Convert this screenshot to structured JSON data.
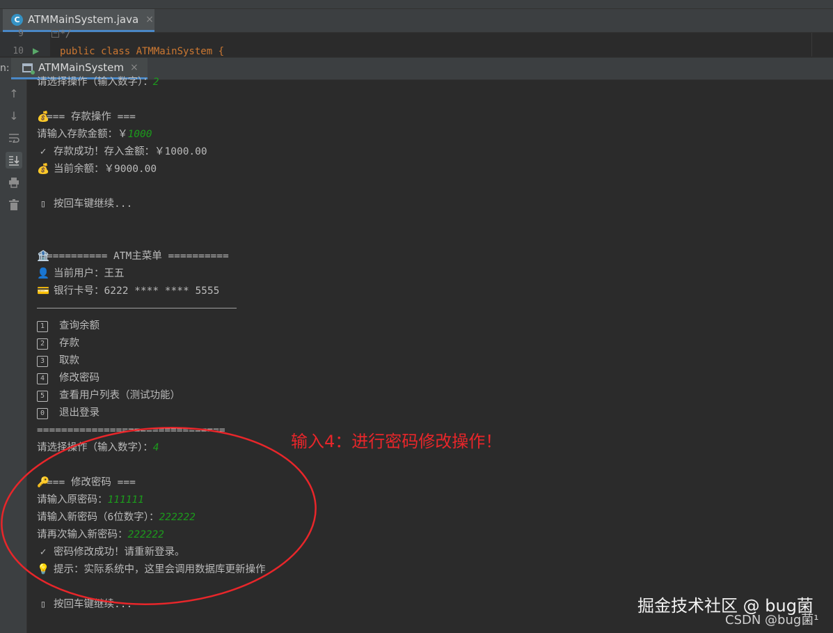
{
  "editor": {
    "tab_label": "ATMMainSystem.java",
    "tab_icon": "java-class-icon",
    "tab_close": "×",
    "line_9": "9",
    "line_10": "10",
    "code_9": "*/",
    "code_10": "public class ATMMainSystem {"
  },
  "run_panel": {
    "prefix": "n:",
    "tab_label": "ATMMainSystem",
    "tab_close": "×"
  },
  "console": {
    "l01": "请选择操作（输入数字）：",
    "l01_in": "2",
    "l02": "=== 存款操作 ===",
    "l03": "请输入存款金额：￥",
    "l03_in": "1000",
    "l04": "存款成功！存入金额：￥1000.00",
    "l05": "当前余额：￥9000.00",
    "l06": "按回车键继续...",
    "l07": "========== ATM主菜单 ==========",
    "l08": "当前用户：王五",
    "l09": "银行卡号：6222 **** **** 5555",
    "menu": [
      {
        "num": "1",
        "label": "查询余额"
      },
      {
        "num": "2",
        "label": "存款"
      },
      {
        "num": "3",
        "label": "取款"
      },
      {
        "num": "4",
        "label": "修改密码"
      },
      {
        "num": "5",
        "label": "查看用户列表（测试功能）"
      },
      {
        "num": "0",
        "label": "退出登录"
      }
    ],
    "sep": "===============================",
    "l10": "请选择操作（输入数字）：",
    "l10_in": "4",
    "l11": "=== 修改密码 ===",
    "l12": "请输入原密码：",
    "l12_in": "111111",
    "l13": "请输入新密码（6位数字）：",
    "l13_in": "222222",
    "l14": "请再次输入新密码：",
    "l14_in": "222222",
    "l15": "密码修改成功！请重新登录。",
    "l16": "提示：实际系统中，这里会调用数据库更新操作",
    "l17": "按回车键继续..."
  },
  "annotation": {
    "text": "输入4：进行密码修改操作！",
    "color": "#e8262a"
  },
  "watermark": {
    "line1": "掘金技术社区 @ bug菌",
    "line2": "CSDN @bug菌¹"
  },
  "colors": {
    "input": "#1c9c1c",
    "accent": "#4a88c7"
  }
}
